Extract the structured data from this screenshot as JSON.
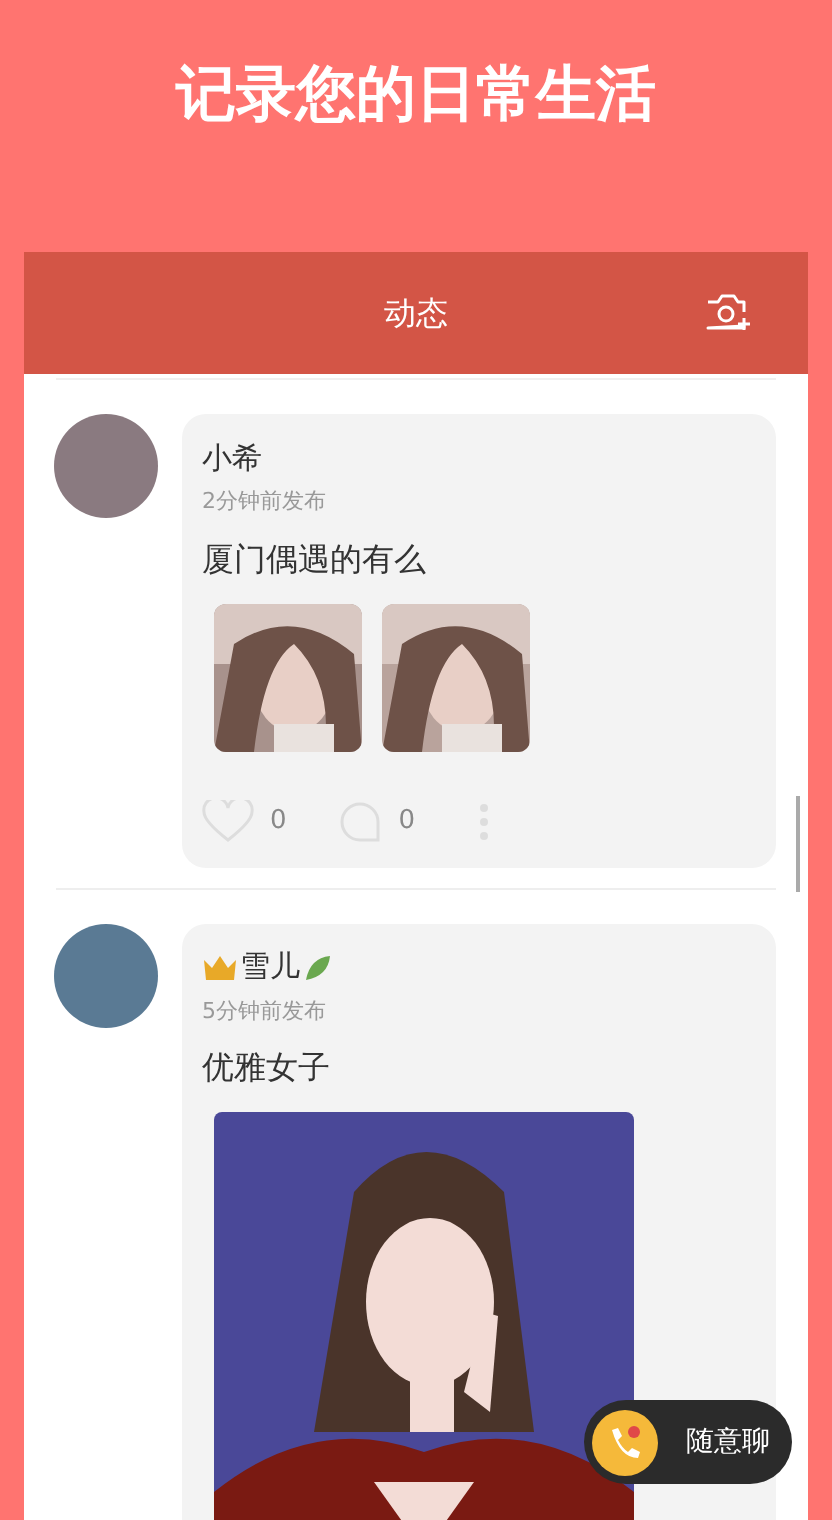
{
  "banner": {
    "title": "记录您的日常生活"
  },
  "header": {
    "title": "动态"
  },
  "posts": [
    {
      "name": "小希",
      "vip": false,
      "time": "2分钟前发布",
      "text": "厦门偶遇的有么",
      "images": [
        {
          "kind": "thumb"
        },
        {
          "kind": "thumb"
        }
      ],
      "likes": "0",
      "comments": "0"
    },
    {
      "name": "雪儿",
      "vip": true,
      "time": "5分钟前发布",
      "text": "优雅女子",
      "images": [
        {
          "kind": "large"
        }
      ]
    }
  ],
  "chat_button": {
    "label": "随意聊"
  }
}
